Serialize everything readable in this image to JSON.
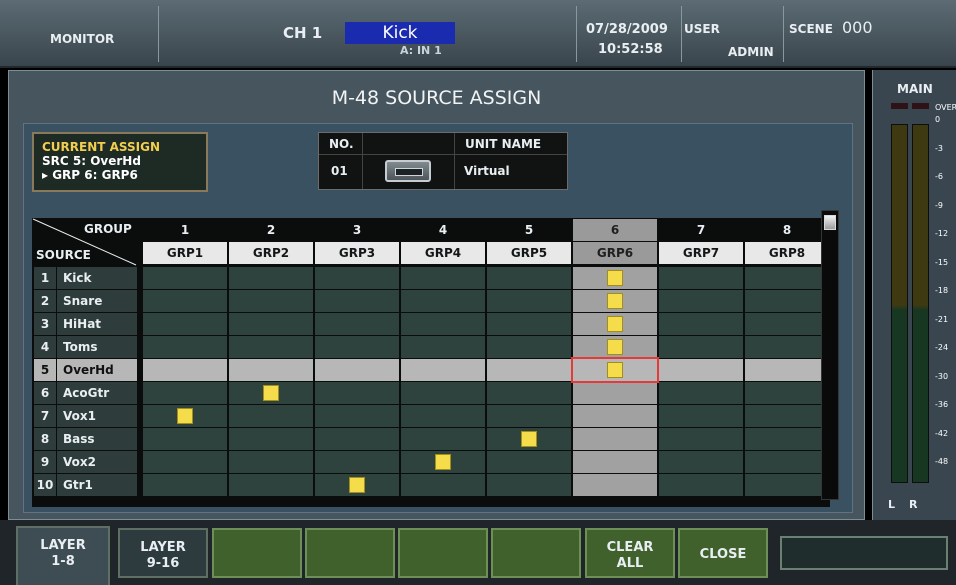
{
  "header": {
    "mode": "MONITOR",
    "ch_label": "CH",
    "ch_number": "1",
    "ch_name": "Kick",
    "ch_source": "A: IN 1",
    "date": "07/28/2009",
    "time": "10:52:58",
    "user_label": "USER",
    "user_name": "ADMIN",
    "scene_label": "SCENE",
    "scene_number": "000"
  },
  "title": "M-48 SOURCE ASSIGN",
  "current_assign": {
    "label": "CURRENT ASSIGN",
    "src": "SRC 5: OverHd",
    "grp": "▸ GRP 6: GRP6"
  },
  "unit": {
    "no_label": "NO.",
    "no_value": "01",
    "name_label": "UNIT NAME",
    "name_value": "Virtual"
  },
  "grid": {
    "group_label": "GROUP",
    "source_label": "SOURCE",
    "columns": [
      {
        "num": "1",
        "name": "GRP1"
      },
      {
        "num": "2",
        "name": "GRP2"
      },
      {
        "num": "3",
        "name": "GRP3"
      },
      {
        "num": "4",
        "name": "GRP4"
      },
      {
        "num": "5",
        "name": "GRP5"
      },
      {
        "num": "6",
        "name": "GRP6"
      },
      {
        "num": "7",
        "name": "GRP7"
      },
      {
        "num": "8",
        "name": "GRP8"
      }
    ],
    "rows": [
      {
        "num": "1",
        "name": "Kick",
        "group": 6
      },
      {
        "num": "2",
        "name": "Snare",
        "group": 6
      },
      {
        "num": "3",
        "name": "HiHat",
        "group": 6
      },
      {
        "num": "4",
        "name": "Toms",
        "group": 6
      },
      {
        "num": "5",
        "name": "OverHd",
        "group": 6
      },
      {
        "num": "6",
        "name": "AcoGtr",
        "group": 2
      },
      {
        "num": "7",
        "name": "Vox1",
        "group": 1
      },
      {
        "num": "8",
        "name": "Bass",
        "group": 5
      },
      {
        "num": "9",
        "name": "Vox2",
        "group": 4
      },
      {
        "num": "10",
        "name": "Gtr1",
        "group": 3
      }
    ],
    "selected_row": 5,
    "selected_col": 6
  },
  "meter": {
    "label": "MAIN",
    "left_label": "L",
    "right_label": "R",
    "scale": [
      "OVER",
      "0",
      "-3",
      "-6",
      "-9",
      "-12",
      "-15",
      "-18",
      "-21",
      "-24",
      "-30",
      "-36",
      "-42",
      "-48"
    ]
  },
  "buttons": {
    "layer_1_8": "LAYER\n1-8",
    "layer_9_16": "LAYER\n9-16",
    "clear_all": "CLEAR\nALL",
    "close": "CLOSE"
  },
  "colors": {
    "assign_mark": "#f4dc4a",
    "selection": "#e43a3a",
    "button_green": "#40602c"
  }
}
